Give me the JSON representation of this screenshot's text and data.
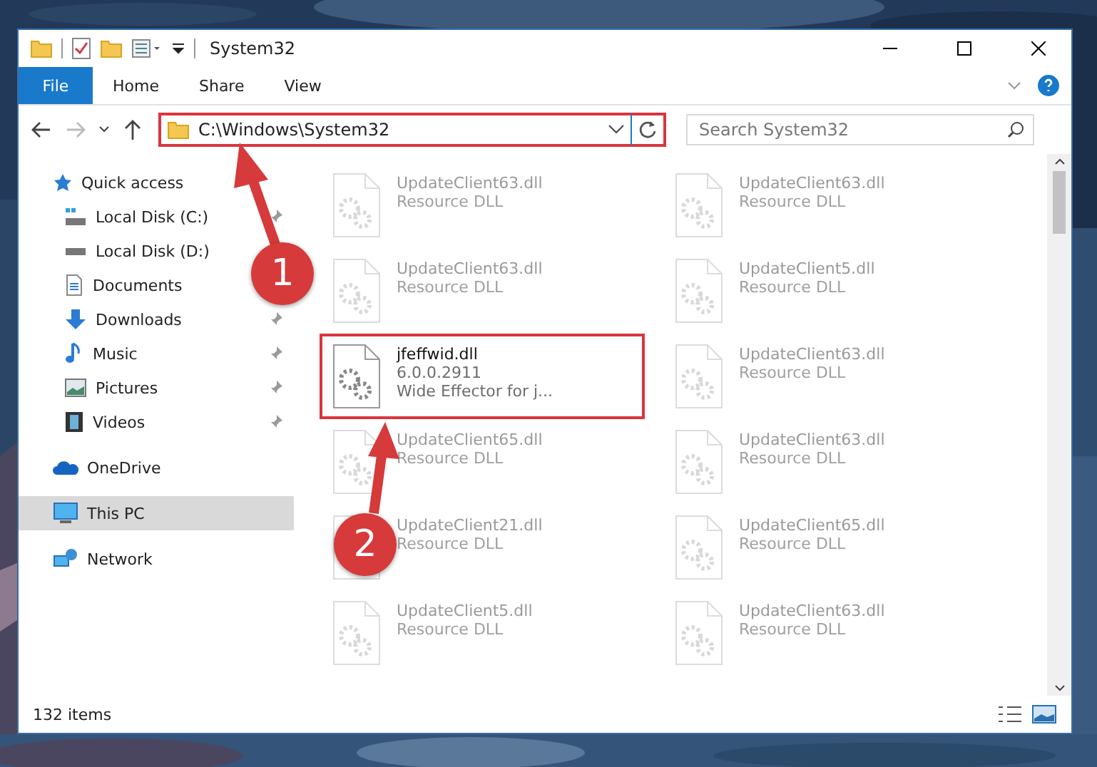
{
  "window": {
    "title": "System32"
  },
  "ribbon": {
    "tabs": [
      {
        "label": "File",
        "kind": "file"
      },
      {
        "label": "Home",
        "kind": "tab"
      },
      {
        "label": "Share",
        "kind": "tab"
      },
      {
        "label": "View",
        "kind": "tab"
      }
    ]
  },
  "address": {
    "path": "C:\\Windows\\System32",
    "highlighted": true
  },
  "search": {
    "placeholder": "Search System32"
  },
  "sidebar": {
    "items": [
      {
        "label": "Quick access",
        "kind": "star",
        "selected": false,
        "children": [
          {
            "label": "Local Disk (C:)",
            "kind": "system-drive",
            "pinned": true
          },
          {
            "label": "Local Disk (D:)",
            "kind": "drive",
            "pinned": false
          },
          {
            "label": "Documents",
            "kind": "documents",
            "pinned": false
          },
          {
            "label": "Downloads",
            "kind": "downloads",
            "pinned": true
          },
          {
            "label": "Music",
            "kind": "music",
            "pinned": true
          },
          {
            "label": "Pictures",
            "kind": "pictures",
            "pinned": true
          },
          {
            "label": "Videos",
            "kind": "videos",
            "pinned": true
          }
        ]
      },
      {
        "label": "OneDrive",
        "kind": "cloud",
        "selected": false
      },
      {
        "label": "This PC",
        "kind": "pc",
        "selected": true
      },
      {
        "label": "Network",
        "kind": "network",
        "selected": false
      }
    ]
  },
  "files": [
    {
      "name": "UpdateClient63.dll",
      "details": [
        "Resource DLL"
      ],
      "blurred": true,
      "highlighted": false
    },
    {
      "name": "UpdateClient63.dll",
      "details": [
        "Resource DLL"
      ],
      "blurred": true,
      "highlighted": false
    },
    {
      "name": "UpdateClient63.dll",
      "details": [
        "Resource DLL"
      ],
      "blurred": true,
      "highlighted": false
    },
    {
      "name": "UpdateClient5.dll",
      "details": [
        "Resource DLL"
      ],
      "blurred": true,
      "highlighted": false
    },
    {
      "name": "jfeffwid.dll",
      "details": [
        "6.0.0.2911",
        "Wide Effector for j..."
      ],
      "blurred": false,
      "highlighted": true
    },
    {
      "name": "UpdateClient63.dll",
      "details": [
        "Resource DLL"
      ],
      "blurred": true,
      "highlighted": false
    },
    {
      "name": "UpdateClient65.dll",
      "details": [
        "Resource DLL"
      ],
      "blurred": true,
      "highlighted": false
    },
    {
      "name": "UpdateClient63.dll",
      "details": [
        "Resource DLL"
      ],
      "blurred": true,
      "highlighted": false
    },
    {
      "name": "UpdateClient21.dll",
      "details": [
        "Resource DLL"
      ],
      "blurred": true,
      "highlighted": false
    },
    {
      "name": "UpdateClient65.dll",
      "details": [
        "Resource DLL"
      ],
      "blurred": true,
      "highlighted": false
    },
    {
      "name": "UpdateClient5.dll",
      "details": [
        "Resource DLL"
      ],
      "blurred": true,
      "highlighted": false
    },
    {
      "name": "UpdateClient63.dll",
      "details": [
        "Resource DLL"
      ],
      "blurred": true,
      "highlighted": false
    }
  ],
  "status_bar": {
    "count": "132 items"
  },
  "callouts": [
    {
      "number": "1"
    },
    {
      "number": "2"
    }
  ]
}
